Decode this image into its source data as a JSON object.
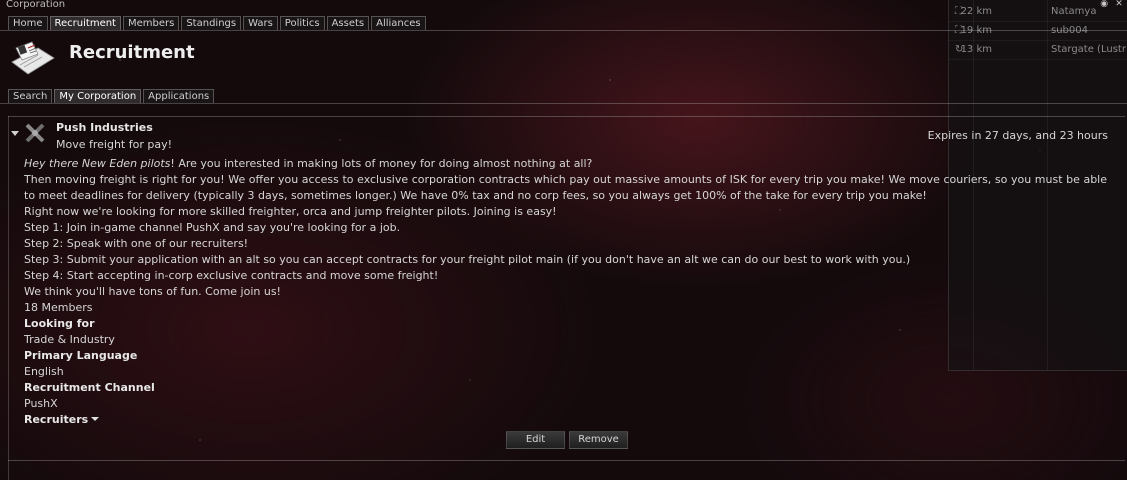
{
  "window": {
    "title": "Corporation",
    "buttons": [
      "◉",
      "✕"
    ]
  },
  "tabs": [
    "Home",
    "Recruitment",
    "Members",
    "Standings",
    "Wars",
    "Politics",
    "Assets",
    "Alliances"
  ],
  "header": {
    "title": "Recruitment"
  },
  "subtabs": [
    "Search",
    "My Corporation",
    "Applications"
  ],
  "ad": {
    "corp_name": "Push Industries",
    "tagline": "Move freight for pay!",
    "expires": "Expires in 27 days, and 23 hours",
    "intro_italic": "Hey there New Eden pilots",
    "intro_rest": "! Are you interested in making lots of money for doing almost nothing at all?",
    "body": [
      "Then moving freight is right for you! We offer you access to exclusive corporation contracts which pay out massive amounts of ISK for every trip you make! We move couriers, so you must be able to meet deadlines for delivery (typically 3 days, sometimes longer.) We have 0% tax and no corp fees, so you always get 100% of the take for every trip you make!",
      "Right now we're looking for more skilled freighter, orca and jump freighter pilots. Joining is easy!",
      "Step 1: Join in-game channel PushX and say you're looking for a job.",
      "Step 2: Speak with one of our recruiters!",
      "Step 3: Submit your application with an alt so you can accept contracts for your freight pilot main (if you don't have an alt we can do our best to work with you.)",
      "Step 4: Start accepting in-corp exclusive contracts and move some freight!",
      "We think you'll have tons of fun. Come join us!"
    ],
    "members": "18 Members",
    "looking_for_label": "Looking for",
    "looking_for": "Trade & Industry",
    "language_label": "Primary Language",
    "language": "English",
    "channel_label": "Recruitment Channel",
    "channel": "PushX",
    "recruiters_label": "Recruiters"
  },
  "actions": {
    "edit": "Edit",
    "remove": "Remove"
  },
  "overview": [
    {
      "icon": "⛶",
      "distance": "22 km",
      "name": "Natamya"
    },
    {
      "icon": "⛶",
      "distance": "19 km",
      "name": "sub004"
    },
    {
      "icon": "↻",
      "distance": "13 km",
      "name": "Stargate (Lustr"
    }
  ]
}
